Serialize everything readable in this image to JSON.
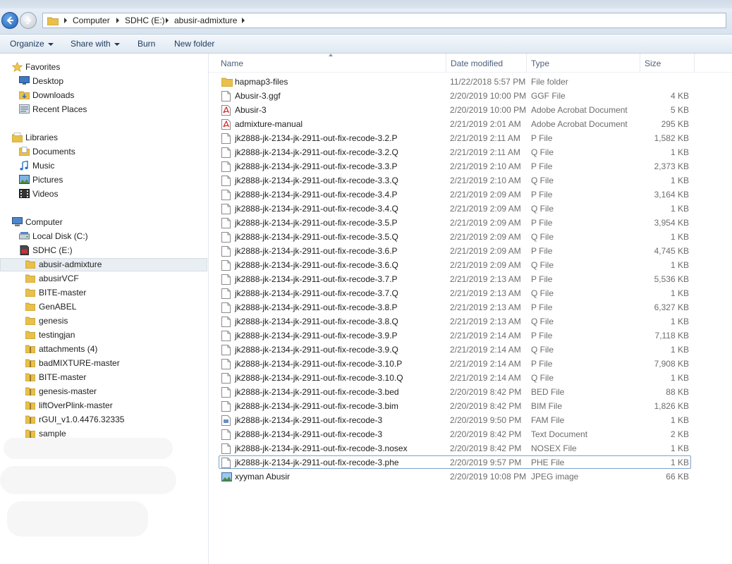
{
  "address": {
    "crumbs": [
      "Computer",
      "SDHC (E:)",
      "abusir-admixture"
    ]
  },
  "toolbar": {
    "organize": "Organize",
    "share_with": "Share with",
    "burn": "Burn",
    "new_folder": "New folder"
  },
  "columns": {
    "name": "Name",
    "date": "Date modified",
    "type": "Type",
    "size": "Size"
  },
  "nav": {
    "favorites": "Favorites",
    "desktop": "Desktop",
    "downloads": "Downloads",
    "recent": "Recent Places",
    "libraries": "Libraries",
    "documents": "Documents",
    "music": "Music",
    "pictures": "Pictures",
    "videos": "Videos",
    "computer": "Computer",
    "local_disk": "Local Disk (C:)",
    "sdhc": "SDHC (E:)",
    "folders": [
      "abusir-admixture",
      "abusirVCF",
      "BITE-master",
      "GenABEL",
      "genesis",
      "testingjan",
      "attachments (4)",
      "badMIXTURE-master",
      "BITE-master",
      "genesis-master",
      "liftOverPlink-master",
      "rGUI_v1.0.4476.32335",
      "sample"
    ]
  },
  "files": [
    {
      "name": "hapmap3-files",
      "date": "11/22/2018 5:57 PM",
      "type": "File folder",
      "size": "",
      "icon": "folder"
    },
    {
      "name": "Abusir-3.ggf",
      "date": "2/20/2019 10:00 PM",
      "type": "GGF File",
      "size": "4 KB",
      "icon": "file"
    },
    {
      "name": "Abusir-3",
      "date": "2/20/2019 10:00 PM",
      "type": "Adobe Acrobat Document",
      "size": "5 KB",
      "icon": "pdf"
    },
    {
      "name": "admixture-manual",
      "date": "2/21/2019 2:01 AM",
      "type": "Adobe Acrobat Document",
      "size": "295 KB",
      "icon": "pdf"
    },
    {
      "name": "jk2888-jk-2134-jk-2911-out-fix-recode-3.2.P",
      "date": "2/21/2019 2:11 AM",
      "type": "P File",
      "size": "1,582 KB",
      "icon": "file"
    },
    {
      "name": "jk2888-jk-2134-jk-2911-out-fix-recode-3.2.Q",
      "date": "2/21/2019 2:11 AM",
      "type": "Q File",
      "size": "1 KB",
      "icon": "file"
    },
    {
      "name": "jk2888-jk-2134-jk-2911-out-fix-recode-3.3.P",
      "date": "2/21/2019 2:10 AM",
      "type": "P File",
      "size": "2,373 KB",
      "icon": "file"
    },
    {
      "name": "jk2888-jk-2134-jk-2911-out-fix-recode-3.3.Q",
      "date": "2/21/2019 2:10 AM",
      "type": "Q File",
      "size": "1 KB",
      "icon": "file"
    },
    {
      "name": "jk2888-jk-2134-jk-2911-out-fix-recode-3.4.P",
      "date": "2/21/2019 2:09 AM",
      "type": "P File",
      "size": "3,164 KB",
      "icon": "file"
    },
    {
      "name": "jk2888-jk-2134-jk-2911-out-fix-recode-3.4.Q",
      "date": "2/21/2019 2:09 AM",
      "type": "Q File",
      "size": "1 KB",
      "icon": "file"
    },
    {
      "name": "jk2888-jk-2134-jk-2911-out-fix-recode-3.5.P",
      "date": "2/21/2019 2:09 AM",
      "type": "P File",
      "size": "3,954 KB",
      "icon": "file"
    },
    {
      "name": "jk2888-jk-2134-jk-2911-out-fix-recode-3.5.Q",
      "date": "2/21/2019 2:09 AM",
      "type": "Q File",
      "size": "1 KB",
      "icon": "file"
    },
    {
      "name": "jk2888-jk-2134-jk-2911-out-fix-recode-3.6.P",
      "date": "2/21/2019 2:09 AM",
      "type": "P File",
      "size": "4,745 KB",
      "icon": "file"
    },
    {
      "name": "jk2888-jk-2134-jk-2911-out-fix-recode-3.6.Q",
      "date": "2/21/2019 2:09 AM",
      "type": "Q File",
      "size": "1 KB",
      "icon": "file"
    },
    {
      "name": "jk2888-jk-2134-jk-2911-out-fix-recode-3.7.P",
      "date": "2/21/2019 2:13 AM",
      "type": "P File",
      "size": "5,536 KB",
      "icon": "file"
    },
    {
      "name": "jk2888-jk-2134-jk-2911-out-fix-recode-3.7.Q",
      "date": "2/21/2019 2:13 AM",
      "type": "Q File",
      "size": "1 KB",
      "icon": "file"
    },
    {
      "name": "jk2888-jk-2134-jk-2911-out-fix-recode-3.8.P",
      "date": "2/21/2019 2:13 AM",
      "type": "P File",
      "size": "6,327 KB",
      "icon": "file"
    },
    {
      "name": "jk2888-jk-2134-jk-2911-out-fix-recode-3.8.Q",
      "date": "2/21/2019 2:13 AM",
      "type": "Q File",
      "size": "1 KB",
      "icon": "file"
    },
    {
      "name": "jk2888-jk-2134-jk-2911-out-fix-recode-3.9.P",
      "date": "2/21/2019 2:14 AM",
      "type": "P File",
      "size": "7,118 KB",
      "icon": "file"
    },
    {
      "name": "jk2888-jk-2134-jk-2911-out-fix-recode-3.9.Q",
      "date": "2/21/2019 2:14 AM",
      "type": "Q File",
      "size": "1 KB",
      "icon": "file"
    },
    {
      "name": "jk2888-jk-2134-jk-2911-out-fix-recode-3.10.P",
      "date": "2/21/2019 2:14 AM",
      "type": "P File",
      "size": "7,908 KB",
      "icon": "file"
    },
    {
      "name": "jk2888-jk-2134-jk-2911-out-fix-recode-3.10.Q",
      "date": "2/21/2019 2:14 AM",
      "type": "Q File",
      "size": "1 KB",
      "icon": "file"
    },
    {
      "name": "jk2888-jk-2134-jk-2911-out-fix-recode-3.bed",
      "date": "2/20/2019 8:42 PM",
      "type": "BED File",
      "size": "88 KB",
      "icon": "file"
    },
    {
      "name": "jk2888-jk-2134-jk-2911-out-fix-recode-3.bim",
      "date": "2/20/2019 8:42 PM",
      "type": "BIM File",
      "size": "1,826 KB",
      "icon": "file"
    },
    {
      "name": "jk2888-jk-2134-jk-2911-out-fix-recode-3",
      "date": "2/20/2019 9:50 PM",
      "type": "FAM File",
      "size": "1 KB",
      "icon": "fam"
    },
    {
      "name": "jk2888-jk-2134-jk-2911-out-fix-recode-3",
      "date": "2/20/2019 8:42 PM",
      "type": "Text Document",
      "size": "2 KB",
      "icon": "file"
    },
    {
      "name": "jk2888-jk-2134-jk-2911-out-fix-recode-3.nosex",
      "date": "2/20/2019 8:42 PM",
      "type": "NOSEX File",
      "size": "1 KB",
      "icon": "file"
    },
    {
      "name": "jk2888-jk-2134-jk-2911-out-fix-recode-3.phe",
      "date": "2/20/2019 9:57 PM",
      "type": "PHE File",
      "size": "1 KB",
      "icon": "file"
    },
    {
      "name": "xyyman Abusir",
      "date": "2/20/2019 10:08 PM",
      "type": "JPEG image",
      "size": "66 KB",
      "icon": "image"
    }
  ],
  "focused_row": 27,
  "colors": {
    "selection": "#e9eef3",
    "focus_border": "#7da2ce",
    "folder": "#e8c04a"
  }
}
